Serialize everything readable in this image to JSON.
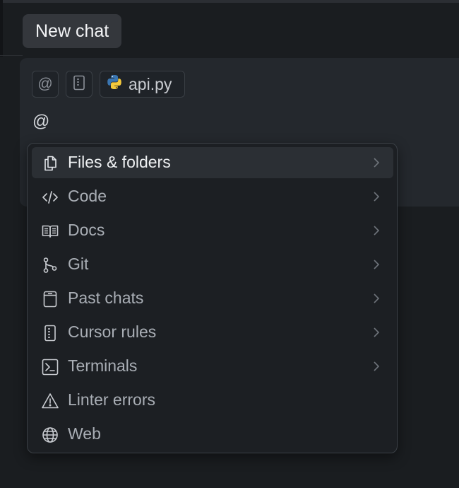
{
  "header": {
    "new_chat_label": "New chat"
  },
  "composer": {
    "chips": [
      {
        "icon": "at-icon",
        "label": "@"
      },
      {
        "icon": "cursor-rules-icon",
        "label": ""
      },
      {
        "icon": "python-icon",
        "label": "api.py"
      }
    ],
    "input_value": "@"
  },
  "menu": {
    "items": [
      {
        "icon": "files-icon",
        "label": "Files & folders",
        "has_submenu": true,
        "active": true
      },
      {
        "icon": "code-icon",
        "label": "Code",
        "has_submenu": true,
        "active": false
      },
      {
        "icon": "docs-icon",
        "label": "Docs",
        "has_submenu": true,
        "active": false
      },
      {
        "icon": "git-icon",
        "label": "Git",
        "has_submenu": true,
        "active": false
      },
      {
        "icon": "past-chats-icon",
        "label": "Past chats",
        "has_submenu": true,
        "active": false
      },
      {
        "icon": "cursor-rules-icon",
        "label": "Cursor rules",
        "has_submenu": true,
        "active": false
      },
      {
        "icon": "terminal-icon",
        "label": "Terminals",
        "has_submenu": true,
        "active": false
      },
      {
        "icon": "warning-icon",
        "label": "Linter errors",
        "has_submenu": false,
        "active": false
      },
      {
        "icon": "globe-icon",
        "label": "Web",
        "has_submenu": false,
        "active": false
      }
    ]
  },
  "colors": {
    "background": "#1a1d20",
    "composer_bg": "#24282d",
    "menu_bg": "#1c1f23",
    "active_item_bg": "#2b2f34",
    "text_primary": "#eef0f2",
    "text_muted": "#a9aeb5",
    "python_blue": "#3a75b0",
    "python_yellow": "#f4c93c"
  }
}
